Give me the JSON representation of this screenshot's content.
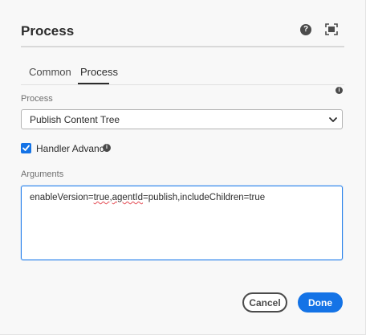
{
  "header": {
    "title": "Process",
    "help_icon": "help-icon",
    "fullscreen_icon": "fullscreen-icon"
  },
  "tabs": [
    {
      "label": "Common",
      "active": false
    },
    {
      "label": "Process",
      "active": true
    }
  ],
  "process": {
    "label": "Process",
    "selected": "Publish Content Tree"
  },
  "handler_advance": {
    "label": "Handler Advance",
    "checked": true
  },
  "arguments": {
    "label": "Arguments",
    "value_prefix": "enableVersion=",
    "value_word1": "true",
    "value_mid1": ",",
    "value_word2": "agentId",
    "value_mid2": "=publish,includeChildren=true"
  },
  "footer": {
    "cancel_label": "Cancel",
    "done_label": "Done"
  },
  "colors": {
    "accent": "#1473e6",
    "focus_border": "#2680eb"
  }
}
